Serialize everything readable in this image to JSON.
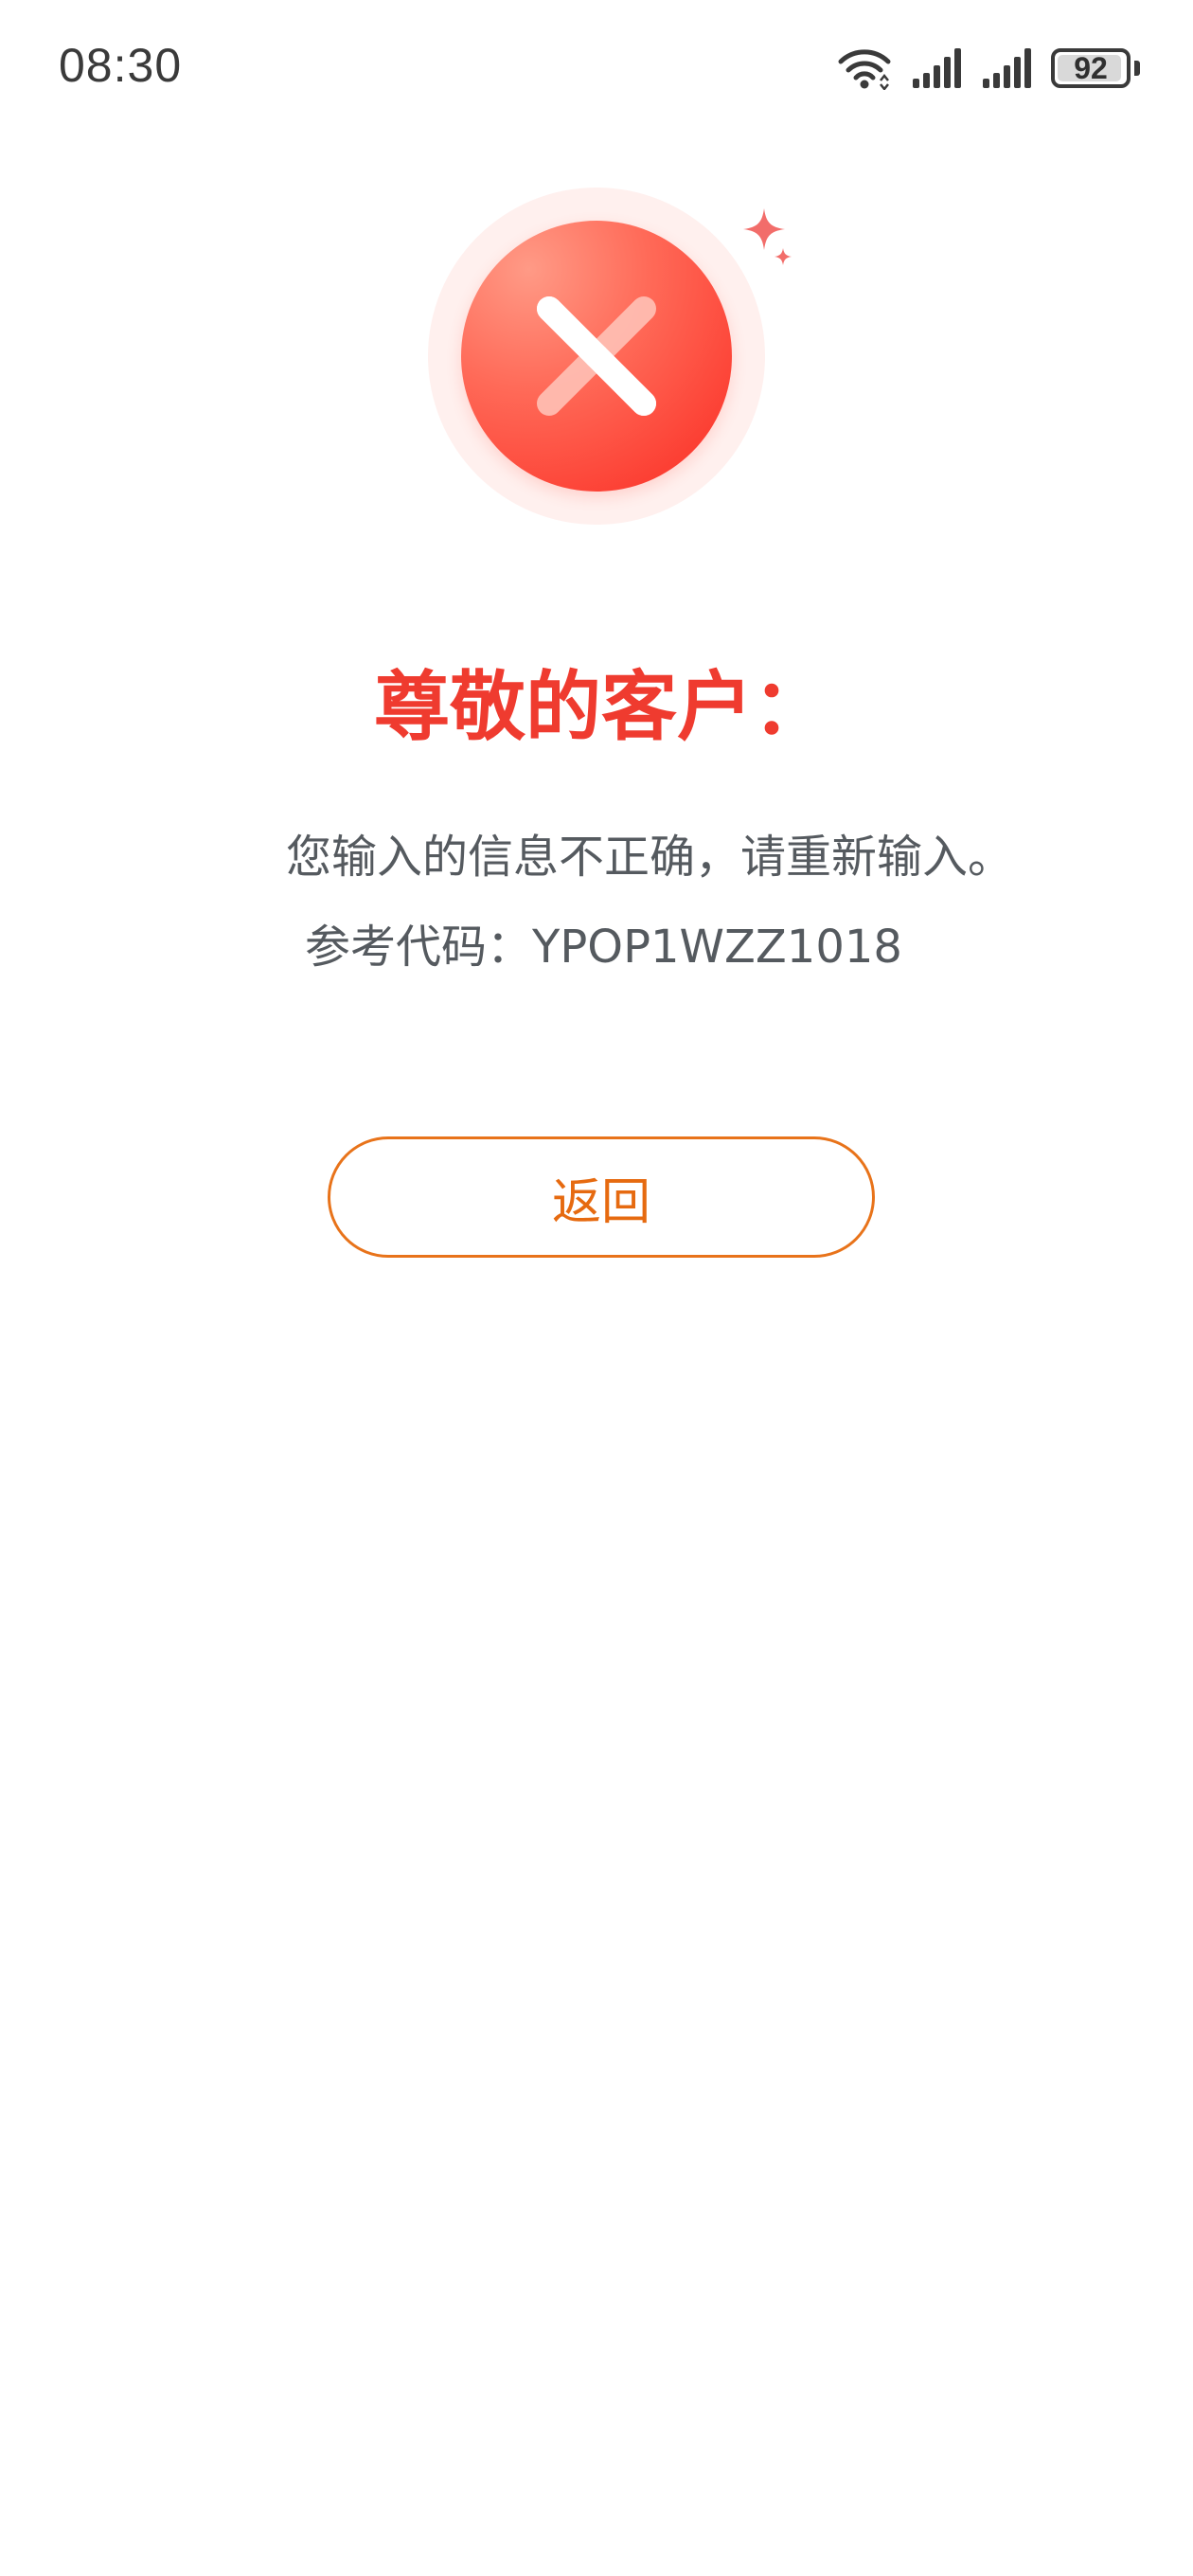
{
  "status_bar": {
    "time": "08:30",
    "battery_level": "92",
    "icons": [
      "wifi-icon",
      "signal-icon",
      "signal-icon",
      "battery-icon"
    ]
  },
  "error": {
    "icon": "error-x-icon",
    "title": "尊敬的客户：",
    "message": "您输入的信息不正确，请重新输入。",
    "reference_label": "参考代码：",
    "reference_code": "YPOP1WZZ1018"
  },
  "actions": {
    "back_label": "返回"
  },
  "colors": {
    "title": "#ef3b2f",
    "accent": "#e8731a",
    "text": "#555a5f",
    "error_red": "#fb2b22"
  }
}
